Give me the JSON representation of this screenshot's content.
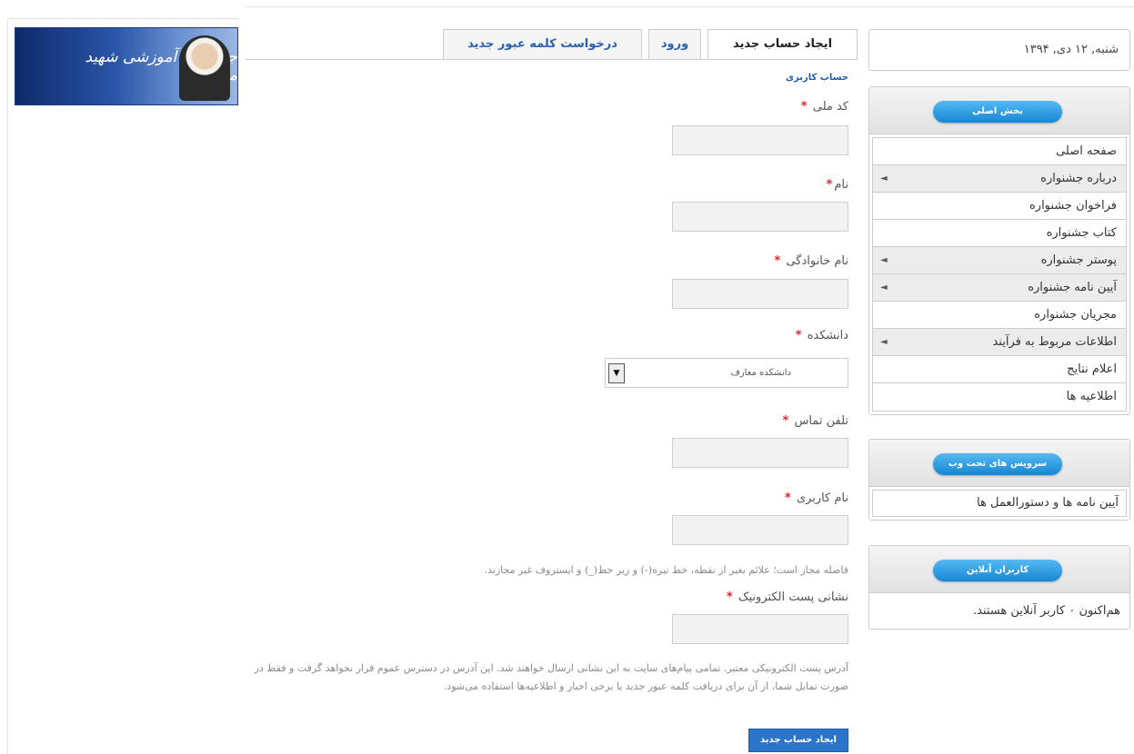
{
  "header": {
    "banner_text": "جشنواره آموزشی شهید مطهری"
  },
  "tabs": [
    {
      "label": "ایجاد حساب جدید",
      "active": true
    },
    {
      "label": "ورود",
      "active": false
    },
    {
      "label": "درخواست کلمه عبور جدید",
      "active": false
    }
  ],
  "form": {
    "section_title": "حساب کاربری",
    "required_mark": "*",
    "fields": {
      "national_code": {
        "label": "کد ملی",
        "value": ""
      },
      "first_name": {
        "label": "نام",
        "value": ""
      },
      "last_name": {
        "label": "نام خانوادگی",
        "value": ""
      },
      "faculty": {
        "label": "دانشکده",
        "selected": "دانشکده معارف"
      },
      "phone": {
        "label": "تلفن تماس",
        "value": ""
      },
      "username": {
        "label": "نام کاربری",
        "value": "",
        "hint": "فاصله مجاز است؛ علائم بغیر از نقطه، خط تیره(-) و زیر خط(_) و ایستروف غیر مجازند."
      },
      "email": {
        "label": "نشانی پست الکترونیک",
        "value": "",
        "hint": "آدرس پست الکترونیکی معتبر. تمامی پیام‌های سایت به این نشانی ارسال خواهند شد. این آدرس در دسترس عموم قرار نخواهد گرفت و فقط در صورت تمایل شما، از آن برای دریافت کلمه عبور جدید یا برخی اخبار و اطلاعیه‌ها استفاده می‌شود."
      }
    },
    "submit_label": "ایجاد حساب جدید"
  },
  "sidebar": {
    "date": "شنبه, ۱۲ دی, ۱۳۹۴",
    "main_section": {
      "title": "بخش اصلی",
      "items": [
        {
          "label": "صفحه اصلی",
          "has_sub": false
        },
        {
          "label": "درباره جشنواره",
          "has_sub": true
        },
        {
          "label": "فراخوان جشنواره",
          "has_sub": false
        },
        {
          "label": "کتاب جشنواره",
          "has_sub": false
        },
        {
          "label": "پوستر جشنواره",
          "has_sub": true
        },
        {
          "label": "آیین نامه جشنواره",
          "has_sub": true
        },
        {
          "label": "مجریان جشنواره",
          "has_sub": false
        },
        {
          "label": "اطلاعات مربوط به فرآیند",
          "has_sub": true
        },
        {
          "label": "اعلام نتایج",
          "has_sub": false
        },
        {
          "label": "اطلاعیه ها",
          "has_sub": false
        }
      ]
    },
    "web_services": {
      "title": "سرویس های تحت وب",
      "item": "آیین نامه ها و دستورالعمل ها"
    },
    "online_users": {
      "title": "کاربران آنلاین",
      "text": "هم‌اکنون ۰ کاربر آنلاین هستند."
    },
    "arrow_glyph": "◄",
    "dropdown_glyph": "▼"
  }
}
